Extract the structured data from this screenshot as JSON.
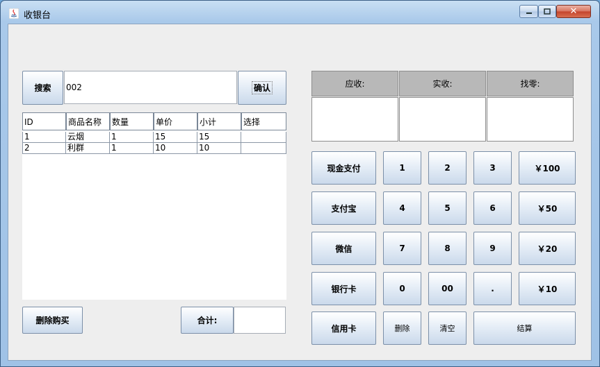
{
  "window": {
    "title": "收银台"
  },
  "search": {
    "button_label": "搜索",
    "value": "002",
    "confirm_label": "确认"
  },
  "table": {
    "headers": [
      "ID",
      "商品名称",
      "数量",
      "单价",
      "小计",
      "选择"
    ],
    "rows": [
      [
        "1",
        "云烟",
        "1",
        "15",
        "15",
        ""
      ],
      [
        "2",
        "利群",
        "1",
        "10",
        "10",
        ""
      ]
    ]
  },
  "actions": {
    "delete_purchase_label": "删除购买",
    "total_label": "合计:",
    "total_value": ""
  },
  "summary": {
    "due_label": "应收:",
    "due_value": "",
    "received_label": "实收:",
    "received_value": "",
    "change_label": "找零:",
    "change_value": ""
  },
  "payment_methods": [
    "现金支付",
    "支付宝",
    "微信",
    "银行卡",
    "信用卡"
  ],
  "keypad": {
    "keys": [
      [
        "1",
        "2",
        "3"
      ],
      [
        "4",
        "5",
        "6"
      ],
      [
        "7",
        "8",
        "9"
      ],
      [
        "0",
        "00",
        "."
      ]
    ],
    "quick_amounts": [
      "￥100",
      "￥50",
      "￥20",
      "￥10"
    ],
    "delete_label": "删除",
    "clear_label": "清空",
    "checkout_label": "结算"
  }
}
